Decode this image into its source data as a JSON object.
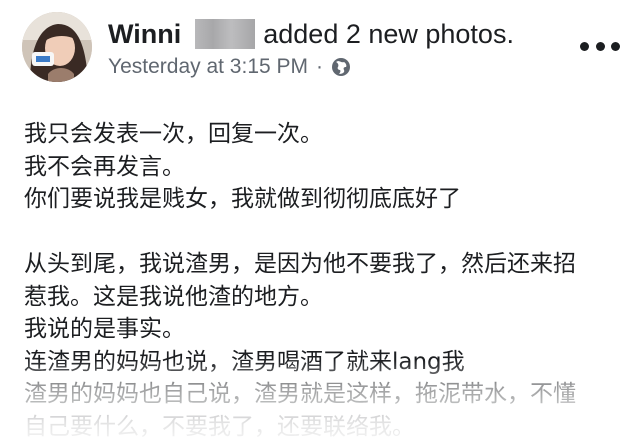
{
  "post": {
    "author_name": "Winni",
    "action_text": "added 2 new photos.",
    "timestamp": "Yesterday at 3:15 PM",
    "meta_separator": "·",
    "privacy_icon": "globe-icon",
    "more_icon": "more-options-icon",
    "body_lines": [
      "我只会发表一次，回复一次。",
      "我不会再发言。",
      "你们要说我是贱女，我就做到彻彻底底好了",
      "",
      "从头到尾，我说渣男，是因为他不要我了，然后还来招",
      "惹我。这是我说他渣的地方。",
      "我说的是事实。",
      "连渣男的妈妈也说，渣男喝酒了就来lang我",
      "渣男的妈妈也自己说，渣男就是这样，拖泥带水，不懂",
      "自己要什么，不要我了，还要联络我。"
    ]
  },
  "colors": {
    "text_primary": "#1c1e21",
    "text_secondary": "#606770",
    "background": "#ffffff"
  }
}
